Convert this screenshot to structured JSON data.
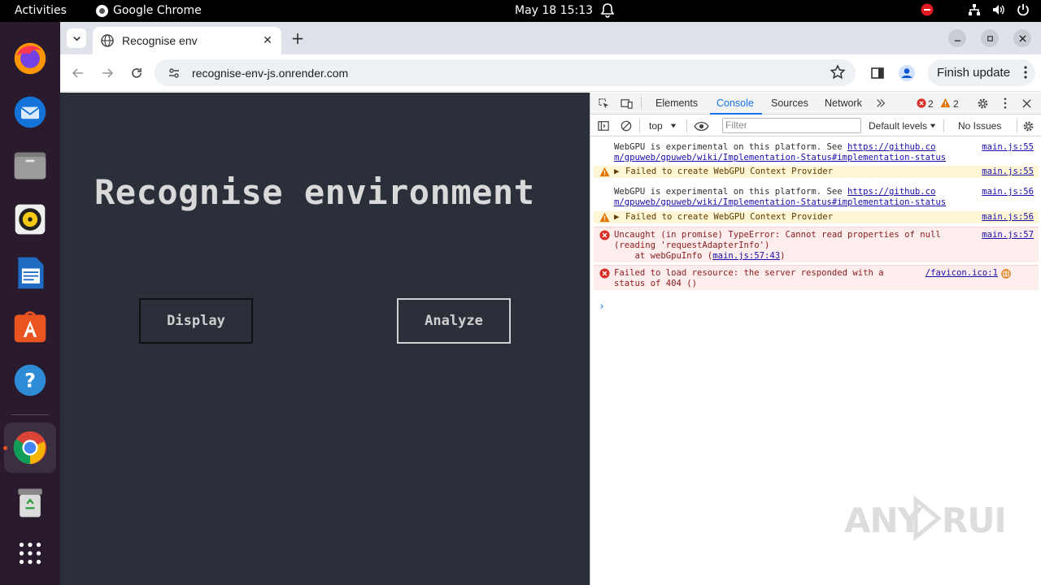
{
  "topbar": {
    "activities": "Activities",
    "app_name": "Google Chrome",
    "clock": "May 18  15:13"
  },
  "dock": {
    "items": [
      "firefox-icon",
      "thunderbird-icon",
      "files-icon",
      "rhythmbox-icon",
      "libreoffice-writer-icon",
      "app-center-icon",
      "help-icon",
      "chrome-icon",
      "trash-icon",
      "show-apps-icon"
    ]
  },
  "chrome": {
    "tab_title": "Recognise env",
    "url": "recognise-env-js.onrender.com",
    "finish_update": "Finish update"
  },
  "page": {
    "title": "Recognise environment",
    "buttons": {
      "display": "Display",
      "analyze": "Analyze"
    },
    "background": "#2b2f3a"
  },
  "devtools": {
    "tabs": [
      "Elements",
      "Console",
      "Sources",
      "Network"
    ],
    "active_tab": "Console",
    "error_count": "2",
    "warning_count": "2",
    "context": "top",
    "filter_placeholder": "Filter",
    "levels": "Default levels",
    "issues": "No Issues",
    "messages": [
      {
        "level": "info",
        "text_line1": "WebGPU is experimental on this platform. See ",
        "link_line1": "https://github.co",
        "link_line2": "m/gpuweb/gpuweb/wiki/Implementation-Status#implementation-status",
        "source": "main.js:55"
      },
      {
        "level": "warning",
        "text": "Failed to create WebGPU Context Provider",
        "source": "main.js:55"
      },
      {
        "level": "info",
        "text_line1": "WebGPU is experimental on this platform. See ",
        "link_line1": "https://github.co",
        "link_line2": "m/gpuweb/gpuweb/wiki/Implementation-Status#implementation-status",
        "source": "main.js:56"
      },
      {
        "level": "warning",
        "text": "Failed to create WebGPU Context Provider",
        "source": "main.js:56"
      },
      {
        "level": "error",
        "text_line1": "Uncaught (in promise) TypeError: Cannot read properties of null",
        "text_line2": "(reading 'requestAdapterInfo')",
        "text_line3_prefix": "    at webGpuInfo (",
        "text_line3_link": "main.js:57:43",
        "text_line3_suffix": ")",
        "source": "main.js:57"
      },
      {
        "level": "error",
        "text_line1": "Failed to load resource: the server responded with a",
        "text_line2": "status of 404 ()",
        "source": "/favicon.ico:1"
      }
    ],
    "prompt": "›"
  },
  "watermark": "ANY RUN",
  "colors": {
    "accent": "#1a73e8",
    "error": "#d93025",
    "warning": "#e37400",
    "dock_bg": "#2a1a2e",
    "ubuntu_orange": "#e95420"
  }
}
